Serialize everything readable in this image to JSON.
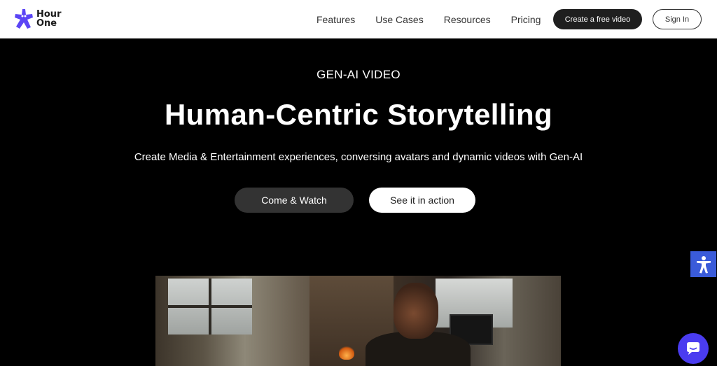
{
  "brand": {
    "name_line1": "Hour",
    "name_line2": "One",
    "accent": "#5b45f5"
  },
  "nav": {
    "items": [
      "Features",
      "Use Cases",
      "Resources",
      "Pricing"
    ]
  },
  "header_actions": {
    "create_label": "Create a free video",
    "signin_label": "Sign In"
  },
  "hero": {
    "eyebrow": "GEN-AI VIDEO",
    "title": "Human-Centric Storytelling",
    "subtitle": "Create Media & Entertainment experiences, conversing avatars and dynamic videos with Gen-AI",
    "primary_button": "Come & Watch",
    "secondary_button": "See it in action"
  },
  "widgets": {
    "accessibility_icon": "accessibility-icon",
    "chat_icon": "chat-icon",
    "accessibility_color": "#3a5bd9",
    "chat_color": "#4a3cf0"
  }
}
